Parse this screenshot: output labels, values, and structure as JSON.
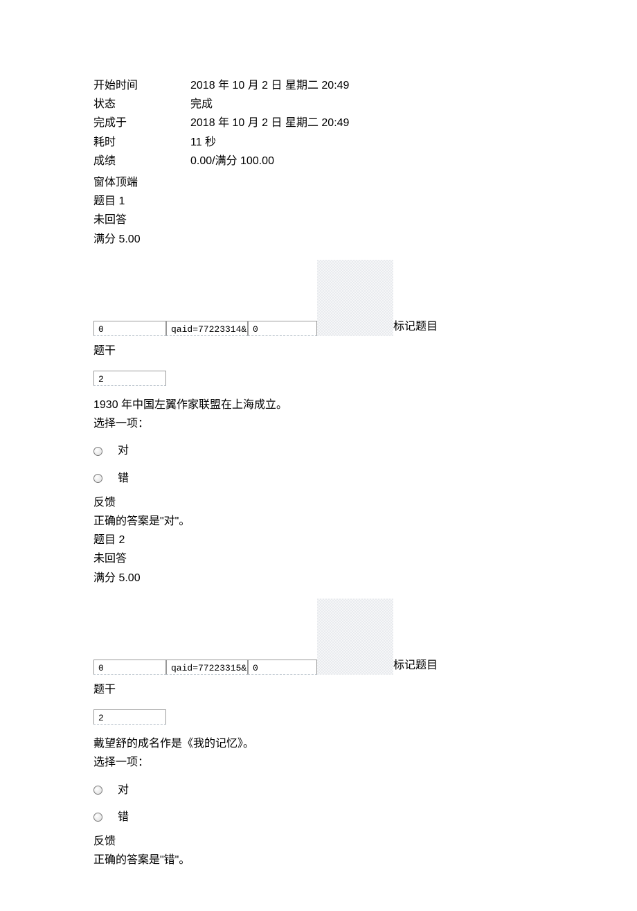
{
  "summary": {
    "start_label": "开始时间",
    "start_value": "2018 年 10 月 2 日  星期二  20:49",
    "state_label": "状态",
    "state_value": "完成",
    "completed_label": "完成于",
    "completed_value": "2018 年 10 月 2 日  星期二  20:49",
    "elapsed_label": "耗时",
    "elapsed_value": "11 秒",
    "grade_label": "成绩",
    "grade_value": "0.00/满分 100.00",
    "formtop_label": "窗体顶端"
  },
  "common": {
    "not_answered": "未回答",
    "max_mark_prefix": "满分 5.00",
    "flag_label": "标记题目",
    "stem_header": "题干",
    "choose_prompt": "选择一项：",
    "option_true": "对",
    "option_false": "错",
    "feedback_header": "反馈"
  },
  "q1": {
    "title": "题目 1",
    "box_a": "0",
    "box_b": "qaid=77223314&",
    "box_c": "0",
    "small_box": "2",
    "text": "1930 年中国左翼作家联盟在上海成立。",
    "correct_answer": "正确的答案是\"对\"。"
  },
  "q2": {
    "title": "题目 2",
    "box_a": "0",
    "box_b": "qaid=77223315&",
    "box_c": "0",
    "small_box": "2",
    "text": "戴望舒的成名作是《我的记忆》。",
    "correct_answer": "正确的答案是\"错\"。"
  }
}
